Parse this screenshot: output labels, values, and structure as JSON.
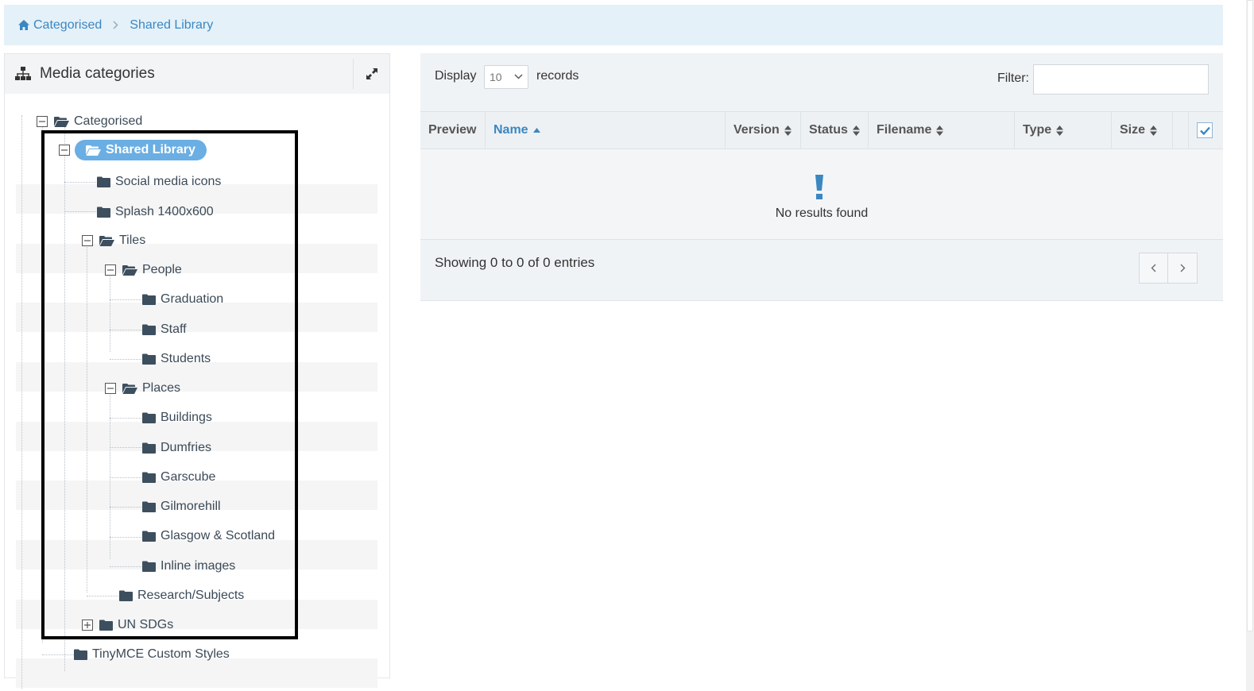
{
  "breadcrumb": {
    "items": [
      {
        "label": "Categorised",
        "icon": "home-icon"
      },
      {
        "label": "Shared Library"
      }
    ]
  },
  "left_panel": {
    "title": "Media categories",
    "icons": {
      "header": "sitemap-icon",
      "action": "expand-icon"
    }
  },
  "tree": {
    "nodes": [
      {
        "label": "Categorised",
        "state": "expanded"
      },
      {
        "label": "Shared Library",
        "state": "expanded",
        "selected": true
      },
      {
        "label": "Social media icons"
      },
      {
        "label": "Splash 1400x600"
      },
      {
        "label": "Tiles",
        "state": "expanded"
      },
      {
        "label": "People",
        "state": "expanded"
      },
      {
        "label": "Graduation"
      },
      {
        "label": "Staff"
      },
      {
        "label": "Students"
      },
      {
        "label": "Places",
        "state": "expanded"
      },
      {
        "label": "Buildings"
      },
      {
        "label": "Dumfries"
      },
      {
        "label": "Garscube"
      },
      {
        "label": "Gilmorehill"
      },
      {
        "label": "Glasgow & Scotland"
      },
      {
        "label": "Inline images"
      },
      {
        "label": "Research/Subjects"
      },
      {
        "label": "UN SDGs",
        "state": "collapsed"
      },
      {
        "label": "TinyMCE Custom Styles"
      }
    ]
  },
  "table": {
    "display_label": "Display",
    "page_size": "10",
    "records_label": "records",
    "filter_label": "Filter:",
    "filter_value": "",
    "columns": [
      "Preview",
      "Name",
      "Version",
      "Status",
      "Filename",
      "Type",
      "Size"
    ],
    "empty_message": "No results found",
    "info": "Showing 0 to 0 of 0 entries",
    "colors": {
      "accent": "#3a87c2",
      "selected_node": "#6aaee3"
    }
  }
}
